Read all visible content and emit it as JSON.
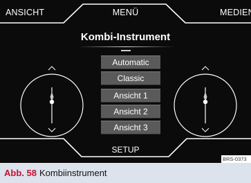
{
  "tabs": {
    "left": "ANSICHT",
    "center": "MENÜ",
    "right": "MEDIEN"
  },
  "title": "Kombi-Instrument",
  "options": [
    "Automatic",
    "Classic",
    "Ansicht 1",
    "Ansicht 2",
    "Ansicht 3"
  ],
  "bottom_button": "SETUP",
  "reference_code": "BRS-0373",
  "caption": {
    "number": "Abb. 58",
    "text": "Kombiinstrument"
  },
  "colors": {
    "background": "#0b0b0b",
    "button": "#5a5a5a",
    "caption_bg": "#dde3ec",
    "caption_accent": "#c8102e"
  },
  "icons": [
    "left-dial-icon",
    "right-dial-icon",
    "chevron-up-icon",
    "chevron-down-icon"
  ]
}
